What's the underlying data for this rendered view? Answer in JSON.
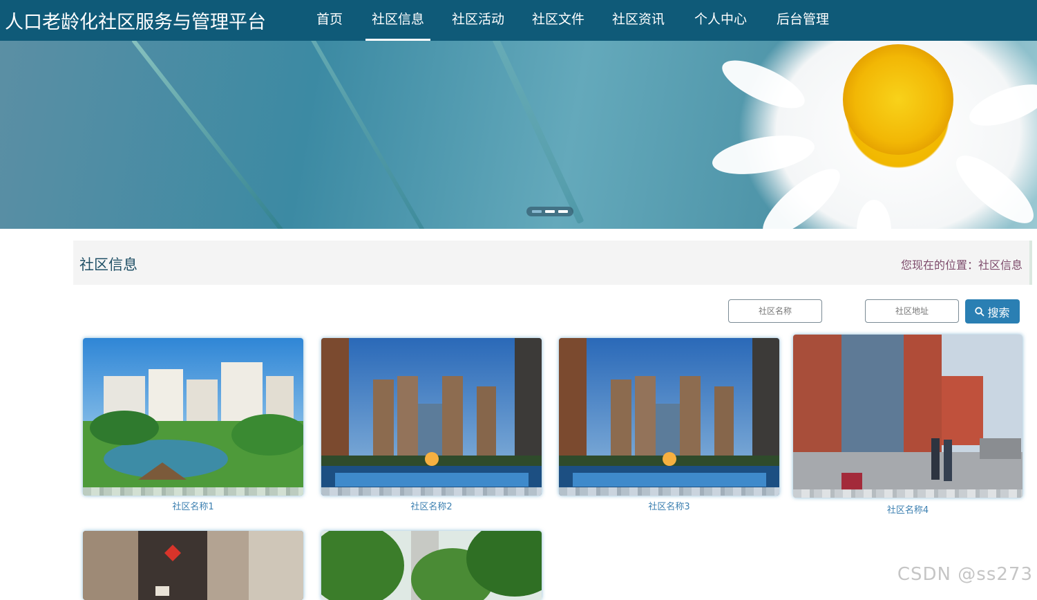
{
  "header": {
    "site_title": "人口老龄化社区服务与管理平台",
    "nav": [
      {
        "label": "首页",
        "active": false
      },
      {
        "label": "社区信息",
        "active": true
      },
      {
        "label": "社区活动",
        "active": false
      },
      {
        "label": "社区文件",
        "active": false
      },
      {
        "label": "社区资讯",
        "active": false
      },
      {
        "label": "个人中心",
        "active": false
      },
      {
        "label": "后台管理",
        "active": false
      }
    ],
    "colors": {
      "bar": "#0f5a78",
      "text": "#ffffff"
    }
  },
  "banner": {
    "image": "daisy-flower-photo",
    "carousel_dots": 3,
    "active_dot": 1
  },
  "section": {
    "title": "社区信息",
    "breadcrumb": "您现在的位置：社区信息"
  },
  "search": {
    "name_placeholder": "社区名称",
    "address_placeholder": "社区地址",
    "button_label": "搜索",
    "button_icon": "search-icon",
    "button_color": "#2a7fb3"
  },
  "communities": [
    {
      "name": "社区名称1",
      "image": "garden-residential-complex"
    },
    {
      "name": "社区名称2",
      "image": "high-rise-pool-night"
    },
    {
      "name": "社区名称3",
      "image": "high-rise-pool-night"
    },
    {
      "name": "社区名称4",
      "image": "street-with-elevator-building"
    },
    {
      "name": "",
      "image": "lobby-interior"
    },
    {
      "name": "",
      "image": "tree-lined-residential"
    }
  ],
  "watermark": "CSDN @ss273"
}
